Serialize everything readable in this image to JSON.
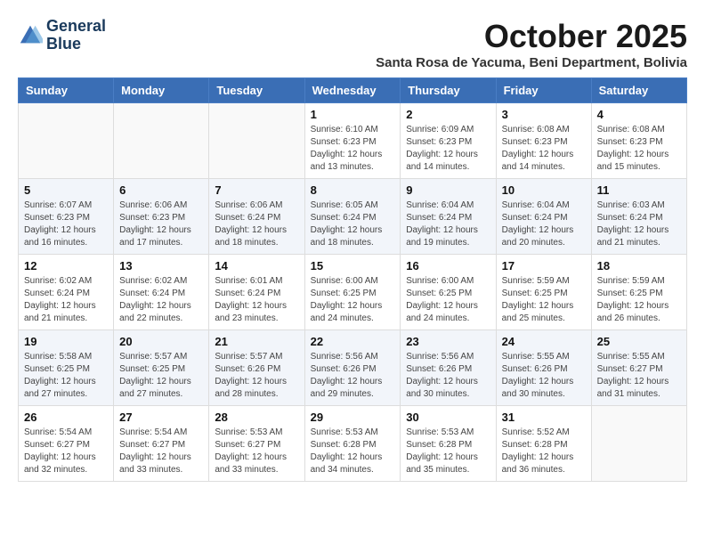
{
  "header": {
    "logo_line1": "General",
    "logo_line2": "Blue",
    "month": "October 2025",
    "location": "Santa Rosa de Yacuma, Beni Department, Bolivia"
  },
  "weekdays": [
    "Sunday",
    "Monday",
    "Tuesday",
    "Wednesday",
    "Thursday",
    "Friday",
    "Saturday"
  ],
  "weeks": [
    [
      {
        "day": "",
        "info": ""
      },
      {
        "day": "",
        "info": ""
      },
      {
        "day": "",
        "info": ""
      },
      {
        "day": "1",
        "info": "Sunrise: 6:10 AM\nSunset: 6:23 PM\nDaylight: 12 hours\nand 13 minutes."
      },
      {
        "day": "2",
        "info": "Sunrise: 6:09 AM\nSunset: 6:23 PM\nDaylight: 12 hours\nand 14 minutes."
      },
      {
        "day": "3",
        "info": "Sunrise: 6:08 AM\nSunset: 6:23 PM\nDaylight: 12 hours\nand 14 minutes."
      },
      {
        "day": "4",
        "info": "Sunrise: 6:08 AM\nSunset: 6:23 PM\nDaylight: 12 hours\nand 15 minutes."
      }
    ],
    [
      {
        "day": "5",
        "info": "Sunrise: 6:07 AM\nSunset: 6:23 PM\nDaylight: 12 hours\nand 16 minutes."
      },
      {
        "day": "6",
        "info": "Sunrise: 6:06 AM\nSunset: 6:23 PM\nDaylight: 12 hours\nand 17 minutes."
      },
      {
        "day": "7",
        "info": "Sunrise: 6:06 AM\nSunset: 6:24 PM\nDaylight: 12 hours\nand 18 minutes."
      },
      {
        "day": "8",
        "info": "Sunrise: 6:05 AM\nSunset: 6:24 PM\nDaylight: 12 hours\nand 18 minutes."
      },
      {
        "day": "9",
        "info": "Sunrise: 6:04 AM\nSunset: 6:24 PM\nDaylight: 12 hours\nand 19 minutes."
      },
      {
        "day": "10",
        "info": "Sunrise: 6:04 AM\nSunset: 6:24 PM\nDaylight: 12 hours\nand 20 minutes."
      },
      {
        "day": "11",
        "info": "Sunrise: 6:03 AM\nSunset: 6:24 PM\nDaylight: 12 hours\nand 21 minutes."
      }
    ],
    [
      {
        "day": "12",
        "info": "Sunrise: 6:02 AM\nSunset: 6:24 PM\nDaylight: 12 hours\nand 21 minutes."
      },
      {
        "day": "13",
        "info": "Sunrise: 6:02 AM\nSunset: 6:24 PM\nDaylight: 12 hours\nand 22 minutes."
      },
      {
        "day": "14",
        "info": "Sunrise: 6:01 AM\nSunset: 6:24 PM\nDaylight: 12 hours\nand 23 minutes."
      },
      {
        "day": "15",
        "info": "Sunrise: 6:00 AM\nSunset: 6:25 PM\nDaylight: 12 hours\nand 24 minutes."
      },
      {
        "day": "16",
        "info": "Sunrise: 6:00 AM\nSunset: 6:25 PM\nDaylight: 12 hours\nand 24 minutes."
      },
      {
        "day": "17",
        "info": "Sunrise: 5:59 AM\nSunset: 6:25 PM\nDaylight: 12 hours\nand 25 minutes."
      },
      {
        "day": "18",
        "info": "Sunrise: 5:59 AM\nSunset: 6:25 PM\nDaylight: 12 hours\nand 26 minutes."
      }
    ],
    [
      {
        "day": "19",
        "info": "Sunrise: 5:58 AM\nSunset: 6:25 PM\nDaylight: 12 hours\nand 27 minutes."
      },
      {
        "day": "20",
        "info": "Sunrise: 5:57 AM\nSunset: 6:25 PM\nDaylight: 12 hours\nand 27 minutes."
      },
      {
        "day": "21",
        "info": "Sunrise: 5:57 AM\nSunset: 6:26 PM\nDaylight: 12 hours\nand 28 minutes."
      },
      {
        "day": "22",
        "info": "Sunrise: 5:56 AM\nSunset: 6:26 PM\nDaylight: 12 hours\nand 29 minutes."
      },
      {
        "day": "23",
        "info": "Sunrise: 5:56 AM\nSunset: 6:26 PM\nDaylight: 12 hours\nand 30 minutes."
      },
      {
        "day": "24",
        "info": "Sunrise: 5:55 AM\nSunset: 6:26 PM\nDaylight: 12 hours\nand 30 minutes."
      },
      {
        "day": "25",
        "info": "Sunrise: 5:55 AM\nSunset: 6:27 PM\nDaylight: 12 hours\nand 31 minutes."
      }
    ],
    [
      {
        "day": "26",
        "info": "Sunrise: 5:54 AM\nSunset: 6:27 PM\nDaylight: 12 hours\nand 32 minutes."
      },
      {
        "day": "27",
        "info": "Sunrise: 5:54 AM\nSunset: 6:27 PM\nDaylight: 12 hours\nand 33 minutes."
      },
      {
        "day": "28",
        "info": "Sunrise: 5:53 AM\nSunset: 6:27 PM\nDaylight: 12 hours\nand 33 minutes."
      },
      {
        "day": "29",
        "info": "Sunrise: 5:53 AM\nSunset: 6:28 PM\nDaylight: 12 hours\nand 34 minutes."
      },
      {
        "day": "30",
        "info": "Sunrise: 5:53 AM\nSunset: 6:28 PM\nDaylight: 12 hours\nand 35 minutes."
      },
      {
        "day": "31",
        "info": "Sunrise: 5:52 AM\nSunset: 6:28 PM\nDaylight: 12 hours\nand 36 minutes."
      },
      {
        "day": "",
        "info": ""
      }
    ]
  ]
}
